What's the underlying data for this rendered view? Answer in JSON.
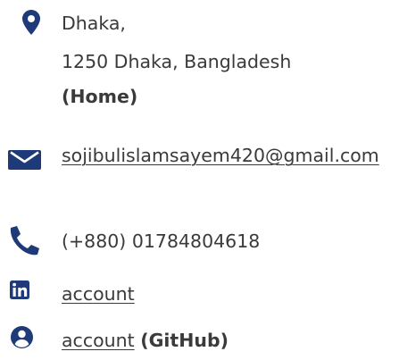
{
  "colors": {
    "accent": "#1e3a78",
    "text": "#3a3a3a"
  },
  "address": {
    "icon": "map-pin-icon",
    "line1": "Dhaka,",
    "line2": "1250 Dhaka, Bangladesh",
    "label": "(Home)"
  },
  "email": {
    "icon": "envelope-icon",
    "value": "sojibulislamsayem420@gmail.com"
  },
  "phone": {
    "icon": "phone-icon",
    "value": "(+880) 01784804618"
  },
  "linkedin": {
    "icon": "linkedin-icon",
    "link_text": "account"
  },
  "github": {
    "icon": "user-circle-icon",
    "link_text": "account",
    "label": "(GitHub)"
  }
}
